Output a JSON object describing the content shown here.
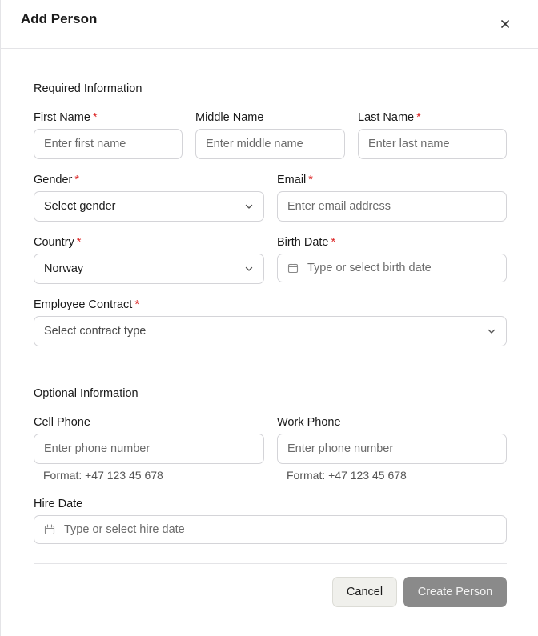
{
  "dialog": {
    "title": "Add Person",
    "close_icon": "close-icon"
  },
  "required": {
    "section_title": "Required Information",
    "required_marker": "*",
    "first_name": {
      "label": "First Name",
      "placeholder": "Enter first name"
    },
    "middle_name": {
      "label": "Middle Name",
      "placeholder": "Enter middle name"
    },
    "last_name": {
      "label": "Last Name",
      "placeholder": "Enter last name"
    },
    "gender": {
      "label": "Gender",
      "value": "Select gender"
    },
    "email": {
      "label": "Email",
      "placeholder": "Enter email address"
    },
    "country": {
      "label": "Country",
      "value": "Norway"
    },
    "birth_date": {
      "label": "Birth Date",
      "placeholder": "Type or select birth date"
    },
    "contract": {
      "label": "Employee Contract",
      "value": "Select contract type"
    }
  },
  "optional": {
    "section_title": "Optional Information",
    "cell_phone": {
      "label": "Cell Phone",
      "placeholder": "Enter phone number",
      "hint": "Format: +47 123 45 678"
    },
    "work_phone": {
      "label": "Work Phone",
      "placeholder": "Enter phone number",
      "hint": "Format: +47 123 45 678"
    },
    "hire_date": {
      "label": "Hire Date",
      "placeholder": "Type or select hire date"
    }
  },
  "footer": {
    "cancel_label": "Cancel",
    "create_label": "Create Person"
  },
  "colors": {
    "required_marker": "#dc2626",
    "create_button_disabled": "#8a8a8a",
    "border": "#d4d4d8"
  }
}
